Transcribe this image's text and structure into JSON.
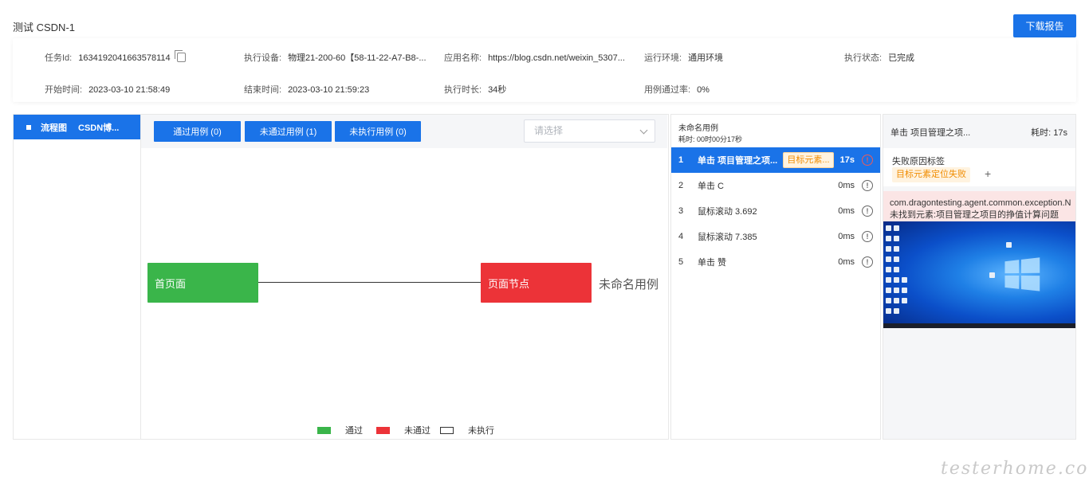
{
  "header": {
    "title": "测试 CSDN-1",
    "download_label": "下载报告"
  },
  "info": {
    "task_id_label": "任务Id:",
    "task_id_value": "1634192041663578114",
    "device_label": "执行设备:",
    "device_value": "物理21-200-60【58-11-22-A7-B8-...",
    "app_label": "应用名称:",
    "app_value": "https://blog.csdn.net/weixin_5307...",
    "env_label": "运行环境:",
    "env_value": "通用环境",
    "status_label": "执行状态:",
    "status_value": "已完成",
    "start_label": "开始时间:",
    "start_value": "2023-03-10 21:58:49",
    "end_label": "结束时间:",
    "end_value": "2023-03-10 21:59:23",
    "duration_label": "执行时长:",
    "duration_value": "34秒",
    "pass_rate_label": "用例通过率:",
    "pass_rate_value": "0%"
  },
  "sidebar": {
    "item_label": "流程图",
    "item_name": "CSDN博..."
  },
  "flow": {
    "btn_pass": "通过用例 (0)",
    "btn_fail": "未通过用例 (1)",
    "btn_notrun": "未执行用例 (0)",
    "select_placeholder": "请选择",
    "node_home": "首页面",
    "node_page": "页面节点",
    "case_label": "未命名用例",
    "legend_pass": "通过",
    "legend_fail": "未通过",
    "legend_notrun": "未执行"
  },
  "steps": {
    "title": "未命名用例",
    "elapsed": "耗时: 00时00分17秒",
    "items": [
      {
        "num": "1",
        "name": "单击 项目管理之项...",
        "tag": "目标元素...",
        "dur": "17s"
      },
      {
        "num": "2",
        "name": "单击 C",
        "dur": "0ms"
      },
      {
        "num": "3",
        "name": "鼠标滚动 3.692",
        "dur": "0ms"
      },
      {
        "num": "4",
        "name": "鼠标滚动 7.385",
        "dur": "0ms"
      },
      {
        "num": "5",
        "name": "单击 赞",
        "dur": "0ms"
      }
    ]
  },
  "detail": {
    "title": "单击 项目管理之项...",
    "time": "耗时: 17s",
    "fail_label": "失败原因标签",
    "fail_tag": "目标元素定位失败",
    "plus": "+",
    "error_line1": "com.dragontesting.agent.common.exception.N",
    "error_line2": "未找到元素:项目管理之项目的挣值计算问题"
  },
  "colors": {
    "primary": "#1a73e8",
    "pass": "#3ab54a",
    "fail": "#ec3338",
    "warning_tag": "#f08c00"
  },
  "watermark": "testerhome.com"
}
